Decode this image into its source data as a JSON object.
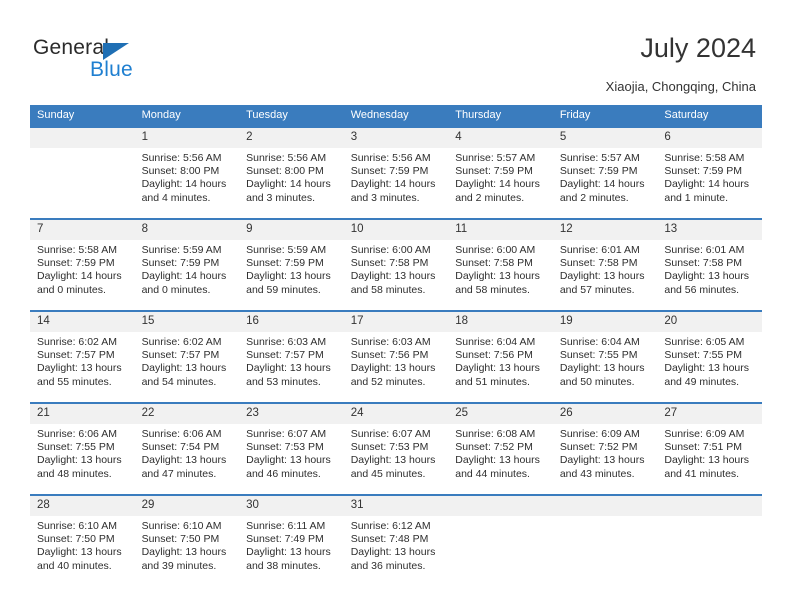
{
  "brand": {
    "name_part1": "General",
    "name_part2": "Blue",
    "accent_color": "#1f7fd0",
    "triangle_color": "#1f6fb4"
  },
  "header": {
    "title": "July 2024",
    "subtitle": "Xiaojia, Chongqing, China"
  },
  "calendar": {
    "header_bg": "#3a7cbe",
    "weekdays": [
      "Sunday",
      "Monday",
      "Tuesday",
      "Wednesday",
      "Thursday",
      "Friday",
      "Saturday"
    ],
    "weeks": [
      [
        {
          "day": "",
          "blank": true
        },
        {
          "day": "1",
          "sunrise": "Sunrise: 5:56 AM",
          "sunset": "Sunset: 8:00 PM",
          "daylight": "Daylight: 14 hours and 4 minutes."
        },
        {
          "day": "2",
          "sunrise": "Sunrise: 5:56 AM",
          "sunset": "Sunset: 8:00 PM",
          "daylight": "Daylight: 14 hours and 3 minutes."
        },
        {
          "day": "3",
          "sunrise": "Sunrise: 5:56 AM",
          "sunset": "Sunset: 7:59 PM",
          "daylight": "Daylight: 14 hours and 3 minutes."
        },
        {
          "day": "4",
          "sunrise": "Sunrise: 5:57 AM",
          "sunset": "Sunset: 7:59 PM",
          "daylight": "Daylight: 14 hours and 2 minutes."
        },
        {
          "day": "5",
          "sunrise": "Sunrise: 5:57 AM",
          "sunset": "Sunset: 7:59 PM",
          "daylight": "Daylight: 14 hours and 2 minutes."
        },
        {
          "day": "6",
          "sunrise": "Sunrise: 5:58 AM",
          "sunset": "Sunset: 7:59 PM",
          "daylight": "Daylight: 14 hours and 1 minute."
        }
      ],
      [
        {
          "day": "7",
          "sunrise": "Sunrise: 5:58 AM",
          "sunset": "Sunset: 7:59 PM",
          "daylight": "Daylight: 14 hours and 0 minutes."
        },
        {
          "day": "8",
          "sunrise": "Sunrise: 5:59 AM",
          "sunset": "Sunset: 7:59 PM",
          "daylight": "Daylight: 14 hours and 0 minutes."
        },
        {
          "day": "9",
          "sunrise": "Sunrise: 5:59 AM",
          "sunset": "Sunset: 7:59 PM",
          "daylight": "Daylight: 13 hours and 59 minutes."
        },
        {
          "day": "10",
          "sunrise": "Sunrise: 6:00 AM",
          "sunset": "Sunset: 7:58 PM",
          "daylight": "Daylight: 13 hours and 58 minutes."
        },
        {
          "day": "11",
          "sunrise": "Sunrise: 6:00 AM",
          "sunset": "Sunset: 7:58 PM",
          "daylight": "Daylight: 13 hours and 58 minutes."
        },
        {
          "day": "12",
          "sunrise": "Sunrise: 6:01 AM",
          "sunset": "Sunset: 7:58 PM",
          "daylight": "Daylight: 13 hours and 57 minutes."
        },
        {
          "day": "13",
          "sunrise": "Sunrise: 6:01 AM",
          "sunset": "Sunset: 7:58 PM",
          "daylight": "Daylight: 13 hours and 56 minutes."
        }
      ],
      [
        {
          "day": "14",
          "sunrise": "Sunrise: 6:02 AM",
          "sunset": "Sunset: 7:57 PM",
          "daylight": "Daylight: 13 hours and 55 minutes."
        },
        {
          "day": "15",
          "sunrise": "Sunrise: 6:02 AM",
          "sunset": "Sunset: 7:57 PM",
          "daylight": "Daylight: 13 hours and 54 minutes."
        },
        {
          "day": "16",
          "sunrise": "Sunrise: 6:03 AM",
          "sunset": "Sunset: 7:57 PM",
          "daylight": "Daylight: 13 hours and 53 minutes."
        },
        {
          "day": "17",
          "sunrise": "Sunrise: 6:03 AM",
          "sunset": "Sunset: 7:56 PM",
          "daylight": "Daylight: 13 hours and 52 minutes."
        },
        {
          "day": "18",
          "sunrise": "Sunrise: 6:04 AM",
          "sunset": "Sunset: 7:56 PM",
          "daylight": "Daylight: 13 hours and 51 minutes."
        },
        {
          "day": "19",
          "sunrise": "Sunrise: 6:04 AM",
          "sunset": "Sunset: 7:55 PM",
          "daylight": "Daylight: 13 hours and 50 minutes."
        },
        {
          "day": "20",
          "sunrise": "Sunrise: 6:05 AM",
          "sunset": "Sunset: 7:55 PM",
          "daylight": "Daylight: 13 hours and 49 minutes."
        }
      ],
      [
        {
          "day": "21",
          "sunrise": "Sunrise: 6:06 AM",
          "sunset": "Sunset: 7:55 PM",
          "daylight": "Daylight: 13 hours and 48 minutes."
        },
        {
          "day": "22",
          "sunrise": "Sunrise: 6:06 AM",
          "sunset": "Sunset: 7:54 PM",
          "daylight": "Daylight: 13 hours and 47 minutes."
        },
        {
          "day": "23",
          "sunrise": "Sunrise: 6:07 AM",
          "sunset": "Sunset: 7:53 PM",
          "daylight": "Daylight: 13 hours and 46 minutes."
        },
        {
          "day": "24",
          "sunrise": "Sunrise: 6:07 AM",
          "sunset": "Sunset: 7:53 PM",
          "daylight": "Daylight: 13 hours and 45 minutes."
        },
        {
          "day": "25",
          "sunrise": "Sunrise: 6:08 AM",
          "sunset": "Sunset: 7:52 PM",
          "daylight": "Daylight: 13 hours and 44 minutes."
        },
        {
          "day": "26",
          "sunrise": "Sunrise: 6:09 AM",
          "sunset": "Sunset: 7:52 PM",
          "daylight": "Daylight: 13 hours and 43 minutes."
        },
        {
          "day": "27",
          "sunrise": "Sunrise: 6:09 AM",
          "sunset": "Sunset: 7:51 PM",
          "daylight": "Daylight: 13 hours and 41 minutes."
        }
      ],
      [
        {
          "day": "28",
          "sunrise": "Sunrise: 6:10 AM",
          "sunset": "Sunset: 7:50 PM",
          "daylight": "Daylight: 13 hours and 40 minutes."
        },
        {
          "day": "29",
          "sunrise": "Sunrise: 6:10 AM",
          "sunset": "Sunset: 7:50 PM",
          "daylight": "Daylight: 13 hours and 39 minutes."
        },
        {
          "day": "30",
          "sunrise": "Sunrise: 6:11 AM",
          "sunset": "Sunset: 7:49 PM",
          "daylight": "Daylight: 13 hours and 38 minutes."
        },
        {
          "day": "31",
          "sunrise": "Sunrise: 6:12 AM",
          "sunset": "Sunset: 7:48 PM",
          "daylight": "Daylight: 13 hours and 36 minutes."
        },
        {
          "day": "",
          "blank": true
        },
        {
          "day": "",
          "blank": true
        },
        {
          "day": "",
          "blank": true
        }
      ]
    ]
  }
}
